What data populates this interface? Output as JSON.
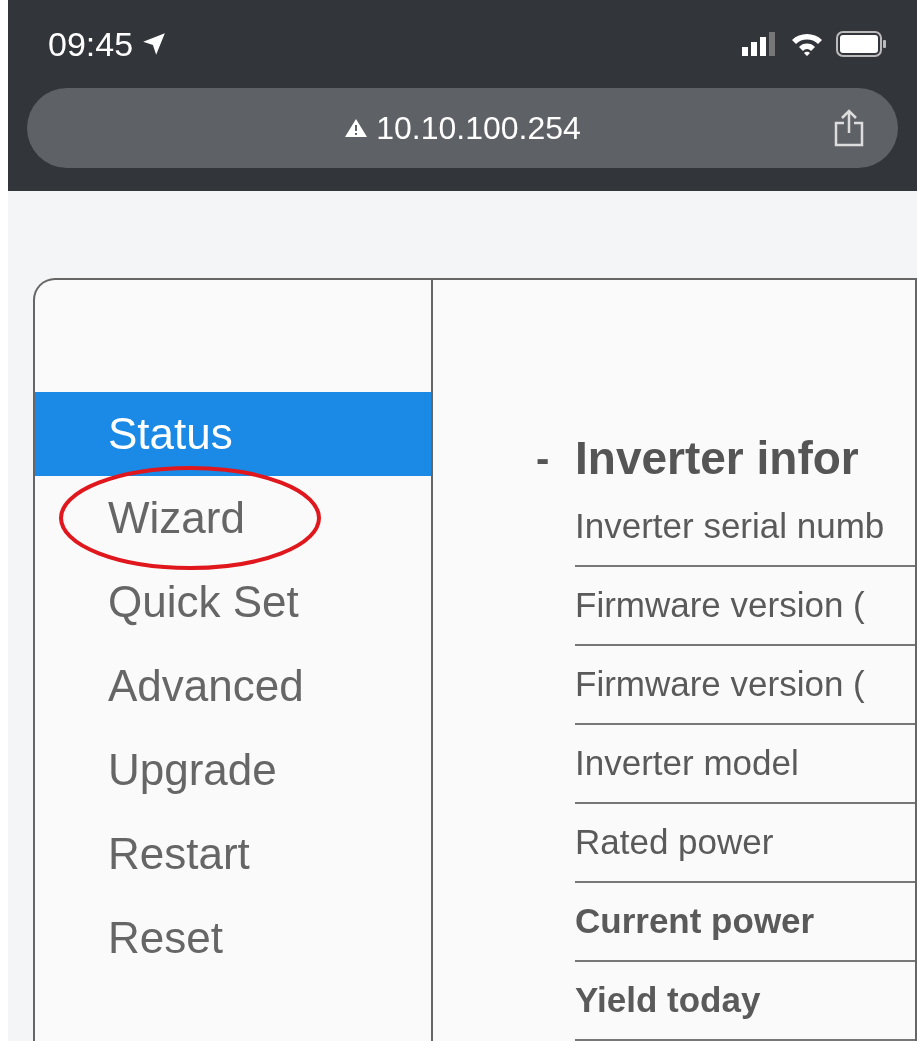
{
  "status_bar": {
    "time": "09:45"
  },
  "address_bar": {
    "url": "10.10.100.254"
  },
  "sidebar": {
    "items": [
      {
        "label": "Status",
        "selected": true,
        "circled": false
      },
      {
        "label": "Wizard",
        "selected": false,
        "circled": true
      },
      {
        "label": "Quick Set",
        "selected": false,
        "circled": false
      },
      {
        "label": "Advanced",
        "selected": false,
        "circled": false
      },
      {
        "label": "Upgrade",
        "selected": false,
        "circled": false
      },
      {
        "label": "Restart",
        "selected": false,
        "circled": false
      },
      {
        "label": "Reset",
        "selected": false,
        "circled": false
      }
    ]
  },
  "section": {
    "toggle": "-",
    "title": "Inverter infor",
    "rows": [
      {
        "label": "Inverter serial numb",
        "bold": false
      },
      {
        "label": "Firmware version (",
        "bold": false
      },
      {
        "label": "Firmware version (",
        "bold": false
      },
      {
        "label": "Inverter model",
        "bold": false
      },
      {
        "label": "Rated power",
        "bold": false
      },
      {
        "label": "Current power",
        "bold": true
      },
      {
        "label": "Yield today",
        "bold": true
      }
    ]
  }
}
